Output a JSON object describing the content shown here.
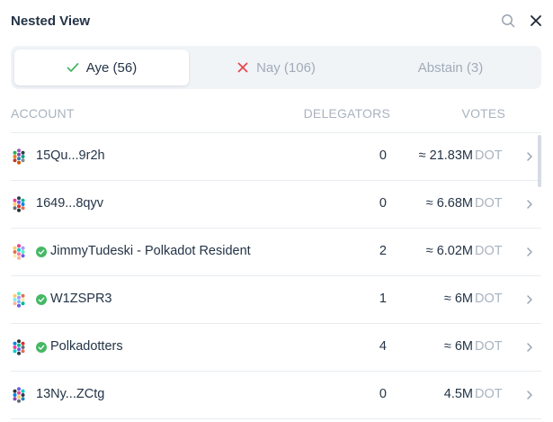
{
  "header": {
    "title": "Nested View",
    "search_icon": "search-icon",
    "close_icon": "close-icon"
  },
  "tabs": [
    {
      "label": "Aye (56)",
      "icon": "check-icon",
      "active": true,
      "icon_color": "#46b865"
    },
    {
      "label": "Nay (106)",
      "icon": "x-icon",
      "active": false,
      "icon_color": "#e5484d"
    },
    {
      "label": "Abstain (3)",
      "icon": "",
      "active": false
    }
  ],
  "table": {
    "columns": {
      "account": "ACCOUNT",
      "delegators": "DELEGATORS",
      "votes": "VOTES"
    },
    "rows": [
      {
        "account": "15Qu...9r2h",
        "verified": false,
        "delegators": "0",
        "votes": "≈ 21.83M",
        "unit": "DOT"
      },
      {
        "account": "1649...8qyv",
        "verified": false,
        "delegators": "0",
        "votes": "≈ 6.68M",
        "unit": "DOT"
      },
      {
        "account": "JimmyTudeski - Polkadot Resident",
        "verified": true,
        "delegators": "2",
        "votes": "≈ 6.02M",
        "unit": "DOT"
      },
      {
        "account": "W1ZSPR3",
        "verified": true,
        "delegators": "1",
        "votes": "≈ 6M",
        "unit": "DOT"
      },
      {
        "account": "Polkadotters",
        "verified": true,
        "delegators": "4",
        "votes": "≈ 6M",
        "unit": "DOT"
      },
      {
        "account": "13Ny...ZCtg",
        "verified": false,
        "delegators": "0",
        "votes": "4.5M",
        "unit": "DOT"
      }
    ]
  },
  "colors": {
    "text": "#243447",
    "muted": "#a9b3c0",
    "aye": "#46b865",
    "nay": "#e5484d"
  }
}
